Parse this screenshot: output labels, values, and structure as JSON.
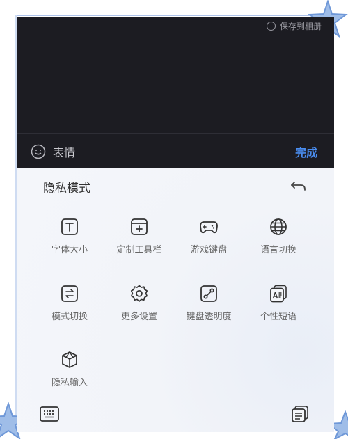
{
  "top": {
    "save_label": "保存到相册",
    "emoji_label": "表情",
    "done_label": "完成"
  },
  "panel": {
    "title": "隐私模式"
  },
  "grid": {
    "items": [
      {
        "label": "字体大小",
        "icon": "font-size-icon"
      },
      {
        "label": "定制工具栏",
        "icon": "custom-toolbar-icon"
      },
      {
        "label": "游戏键盘",
        "icon": "gamepad-icon"
      },
      {
        "label": "语言切换",
        "icon": "globe-icon"
      },
      {
        "label": "模式切换",
        "icon": "mode-switch-icon"
      },
      {
        "label": "更多设置",
        "icon": "gear-icon"
      },
      {
        "label": "键盘透明度",
        "icon": "transparency-icon"
      },
      {
        "label": "个性短语",
        "icon": "phrases-icon"
      },
      {
        "label": "隐私输入",
        "icon": "privacy-input-icon"
      }
    ]
  },
  "colors": {
    "accent": "#4a8df0",
    "dark_bg": "#1c1c22",
    "panel_bg": "#f4f6fa"
  }
}
